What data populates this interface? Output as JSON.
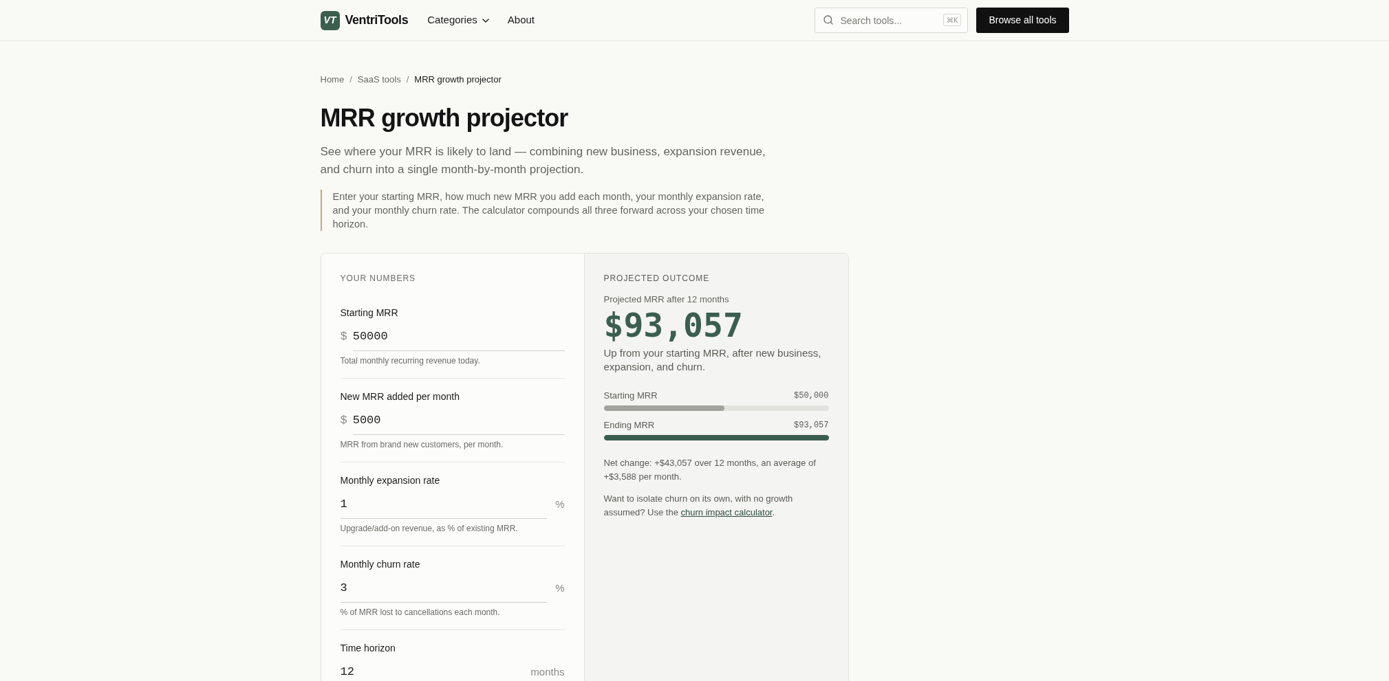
{
  "header": {
    "logo_mark": "VT",
    "brand": "VentriTools",
    "nav": [
      {
        "kind": "dropdown",
        "label": "Categories"
      },
      {
        "kind": "link",
        "label": "About"
      }
    ],
    "search": {
      "placeholder": "Search tools...",
      "shortcut": "⌘K"
    },
    "cta": "Browse all tools"
  },
  "breadcrumb": [
    {
      "kind": "link",
      "label": "Home"
    },
    {
      "kind": "separator",
      "label": "/"
    },
    {
      "kind": "link",
      "label": "SaaS tools"
    },
    {
      "kind": "separator",
      "label": "/"
    },
    {
      "kind": "current",
      "label": "MRR growth projector"
    }
  ],
  "title": "MRR growth projector",
  "subtitle": "See where your MRR is likely to land — combining new business, expansion revenue, and churn into a single month-by-month projection.",
  "callout": "Enter your starting MRR, how much new MRR you add each month, your monthly expansion rate, and your monthly churn rate. The calculator compounds all three forward across your chosen time horizon.",
  "inputs": {
    "heading": "YOUR NUMBERS",
    "fields": [
      {
        "kind": "currency",
        "label": "Starting MRR",
        "unit": "$",
        "value": "50000",
        "hint": "Total monthly recurring revenue today."
      },
      {
        "kind": "currency",
        "label": "New MRR added per month",
        "unit": "$",
        "value": "5000",
        "hint": "MRR from brand new customers, per month."
      },
      {
        "kind": "percent",
        "label": "Monthly expansion rate",
        "unit": "%",
        "value": "1",
        "hint": "Upgrade/add-on revenue, as % of existing MRR."
      },
      {
        "kind": "percent",
        "label": "Monthly churn rate",
        "unit": "%",
        "value": "3",
        "hint": "% of MRR lost to cancellations each month."
      },
      {
        "kind": "duration",
        "label": "Time horizon",
        "unit": "months",
        "value": "12"
      }
    ]
  },
  "results": {
    "heading": "PROJECTED OUTCOME",
    "caption": "Projected MRR after 12 months",
    "total": "$93,057",
    "summary": "Up from your starting MRR, after new business, expansion, and churn.",
    "bars": [
      {
        "kind": "baseline",
        "label": "Starting MRR",
        "value": "$50,000",
        "level": 0.537
      },
      {
        "kind": "projected",
        "label": "Ending MRR",
        "value": "$93,057",
        "level": 1
      }
    ],
    "notes": [
      {
        "kind": "text",
        "text": "Net change: +$43,057 over 12 months, an average of +$3,588 per month."
      },
      {
        "kind": "with_link",
        "text": "Want to isolate churn on its own, with no growth assumed? Use the",
        "link": "churn impact calculator",
        "after": "."
      }
    ]
  }
}
